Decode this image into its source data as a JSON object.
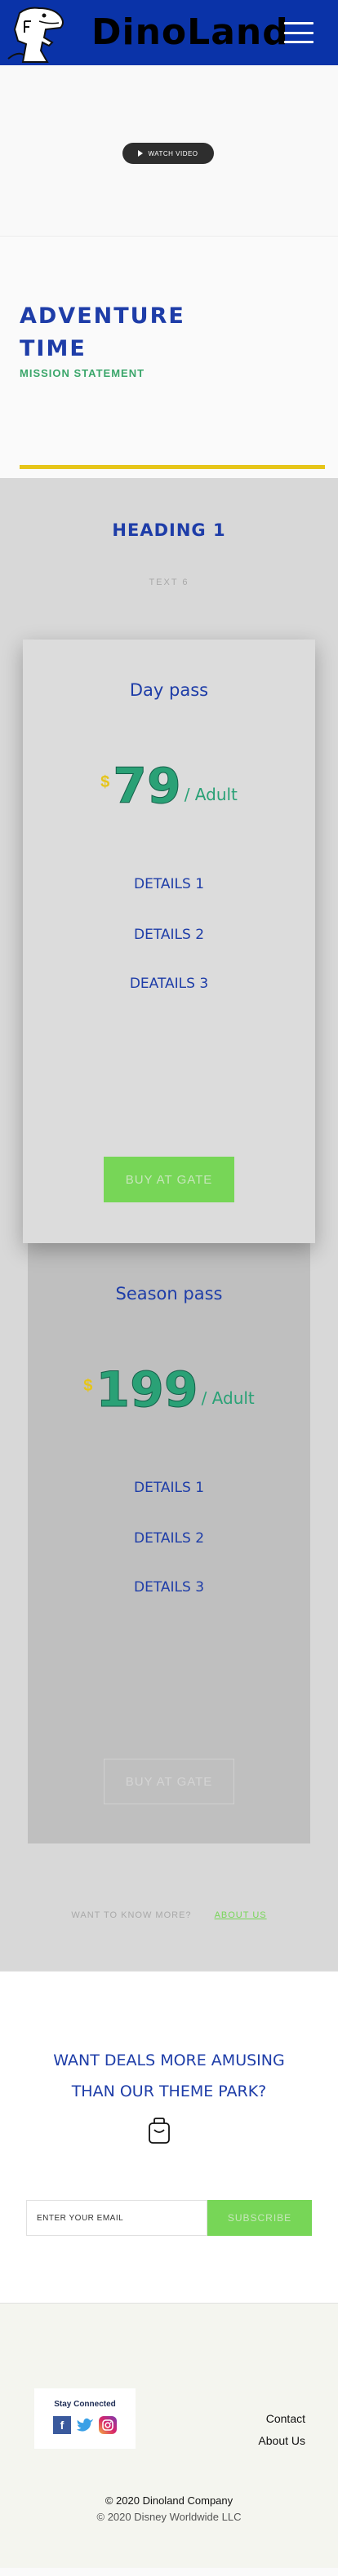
{
  "header": {
    "brand": "DinoLand",
    "menu_icon": "hamburger-icon",
    "logo_icon": "dinosaur-logo-icon",
    "background_color": "#0a33a8"
  },
  "hero": {
    "watch_label": "WATCH VIDEO",
    "play_icon": "play-icon"
  },
  "adventure": {
    "title": "Adventure Time",
    "subtitle": "Mission Statement",
    "accent_color": "#e6c519"
  },
  "pricing": {
    "heading": "Heading 1",
    "text": "Text 6",
    "cards": [
      {
        "title": "Day pass",
        "currency": "$",
        "amount": "79",
        "per": "/ Adult",
        "details": [
          "Details 1",
          "Details 2",
          "Deatails 3"
        ],
        "button": "Buy at gate"
      },
      {
        "title": "Season pass",
        "currency": "$",
        "amount": "199",
        "per": "/ Adult",
        "details": [
          "Details 1",
          "Details 2",
          "Details 3"
        ],
        "button": "Buy at gate"
      }
    ],
    "more_text": "Want to know more?",
    "more_link": "About Us"
  },
  "deals": {
    "title": "Want deals more amusing than our theme park?",
    "bag_icon": "shopping-bag-icon",
    "email_placeholder": "ENTER YOUR EMAIL",
    "subscribe_label": "Subscribe",
    "button_color": "#77d657"
  },
  "footer": {
    "stay_connected": "Stay Connected",
    "social_icons": [
      "facebook-icon",
      "twitter-icon",
      "instagram-icon"
    ],
    "links": [
      "Contact",
      "About Us"
    ],
    "copyright_1": "© 2020 Dinoland  Company",
    "copyright_2": "© 2020 Disney Worldwide LLC"
  }
}
